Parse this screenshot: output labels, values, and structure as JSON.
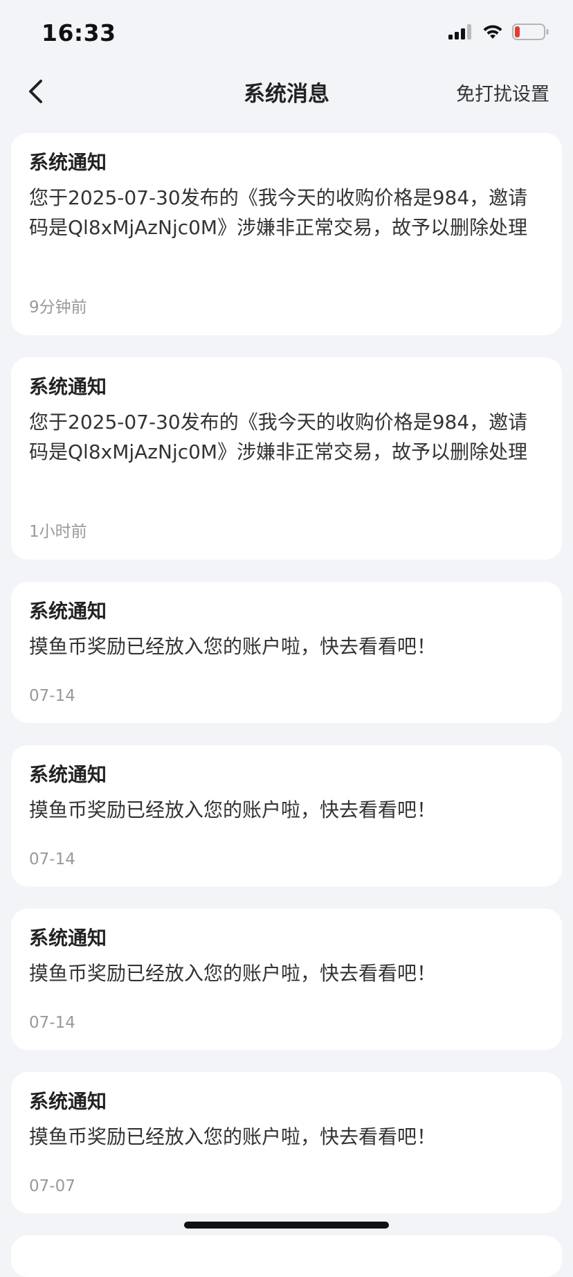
{
  "status_bar": {
    "time": "16:33",
    "icons": [
      "signal-icon",
      "wifi-icon",
      "battery-low-icon"
    ]
  },
  "nav": {
    "back_icon": "chevron-left-icon",
    "title": "系统消息",
    "right_action": "免打扰设置"
  },
  "messages": [
    {
      "title": "系统通知",
      "body": "您于2025-07-30发布的《我今天的收购价格是984，邀请码是Ql8xMjAzNjc0M》涉嫌非正常交易，故予以删除处理",
      "time": "9分钟前"
    },
    {
      "title": "系统通知",
      "body": "您于2025-07-30发布的《我今天的收购价格是984，邀请码是Ql8xMjAzNjc0M》涉嫌非正常交易，故予以删除处理",
      "time": "1小时前"
    },
    {
      "title": "系统通知",
      "body": "摸鱼币奖励已经放入您的账户啦，快去看看吧！",
      "time": "07-14"
    },
    {
      "title": "系统通知",
      "body": "摸鱼币奖励已经放入您的账户啦，快去看看吧！",
      "time": "07-14"
    },
    {
      "title": "系统通知",
      "body": "摸鱼币奖励已经放入您的账户啦，快去看看吧！",
      "time": "07-14"
    },
    {
      "title": "系统通知",
      "body": "摸鱼币奖励已经放入您的账户啦，快去看看吧！",
      "time": "07-07"
    }
  ],
  "colors": {
    "background": "#f2f4f7",
    "card": "#ffffff",
    "battery_low": "#e53935"
  }
}
